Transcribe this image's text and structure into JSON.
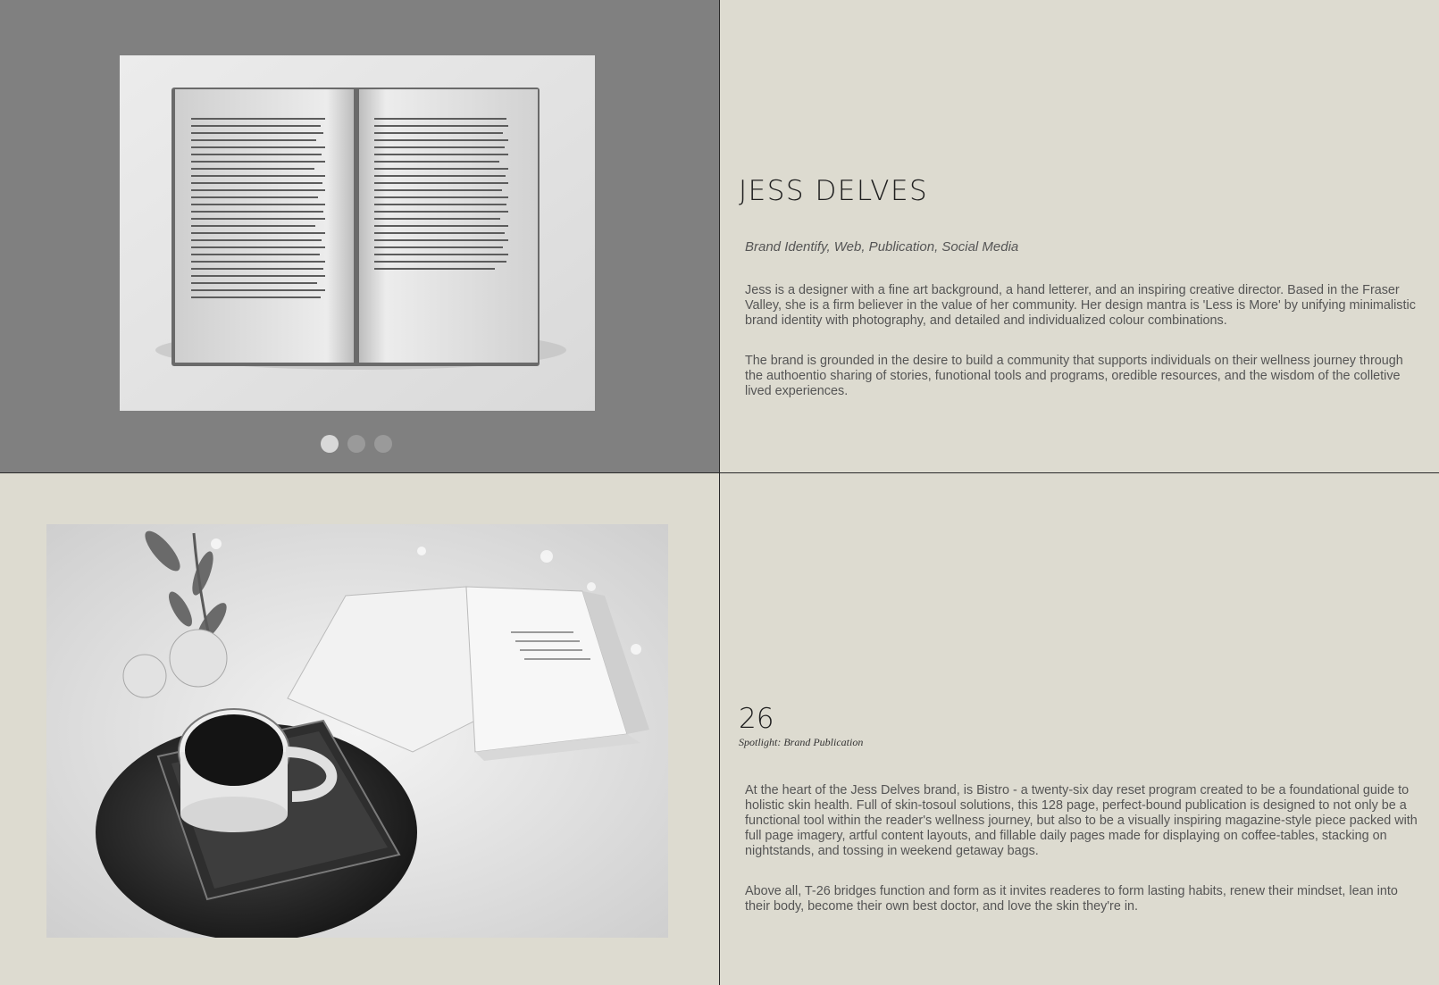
{
  "gallery": {
    "slides": 3,
    "active_index": 0
  },
  "intro": {
    "title": "JESS DELVES",
    "services": "Brand Identify, Web, Publication, Social Media",
    "paragraph_1": "Jess is a designer with a fine art background, a hand letterer, and an inspiring creative director. Based in the Fraser Valley, she is a firm believer in the value of her community. Her design mantra is 'Less is More' by unifying minimalistic brand identity with photography, and detailed and individualized colour combinations.",
    "paragraph_2": "The brand is grounded in the desire to build a community that supports individuals on their wellness journey through the authoentio sharing of stories, funotional tools and programs, oredible resources, and the wisdom of the colletive lived experiences."
  },
  "spotlight": {
    "number": "26",
    "label": "Spotlight: Brand Publication",
    "paragraph_1": "At the heart of the Jess Delves brand, is Bistro - a twenty-six day reset program created to be a foundational guide to holistic skin health. Full of skin-tosoul solutions, this 128 page, perfect-bound publication is designed to not only be a functional tool within the reader's wellness journey, but also to be a visually inspiring magazine-style piece packed with full page imagery, artful content layouts, and fillable daily pages made for displaying on coffee-tables, stacking on nightstands, and tossing in weekend getaway bags.",
    "paragraph_2": "Above all, T-26 bridges function and form as it invites readeres to form lasting habits, renew their mindset, lean into their body, become their own best doctor, and love the skin they're in."
  },
  "colors": {
    "background": "#dddbd0",
    "gallery_bg": "#808080",
    "dot_active": "#d8d8d8",
    "dot_inactive": "#9a9a9a"
  }
}
